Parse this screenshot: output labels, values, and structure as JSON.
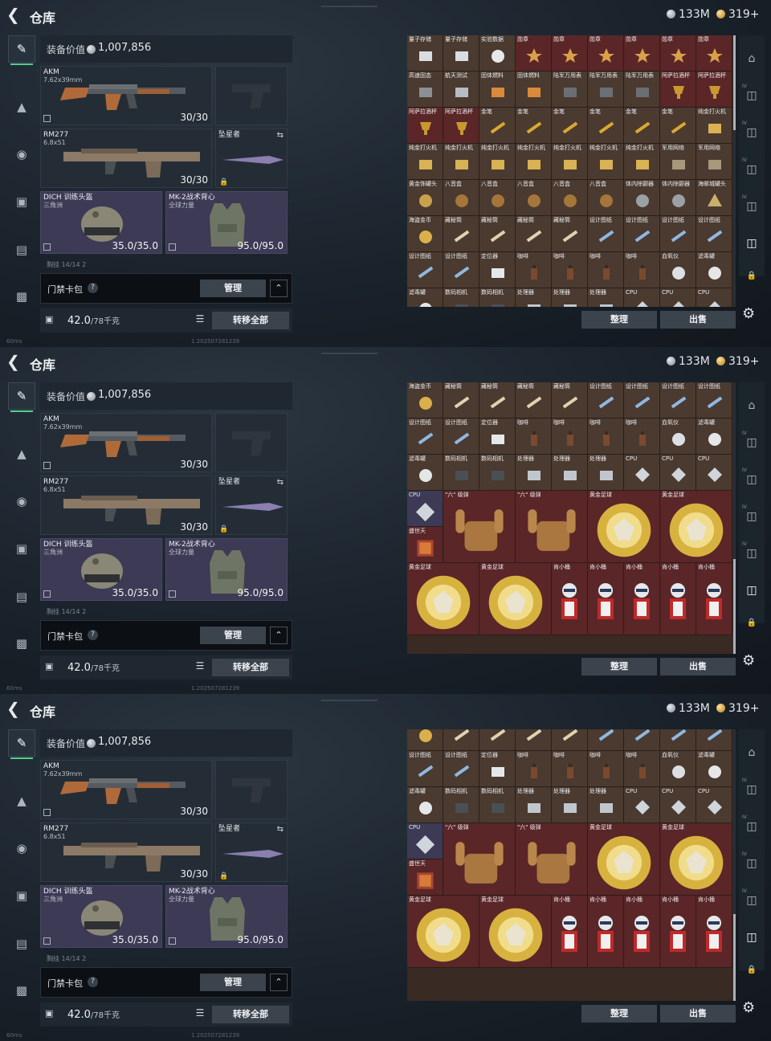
{
  "header": {
    "back_icon": "back-arrow-icon",
    "title": "仓库",
    "silver_currency": "133M",
    "gold_currency": "319+"
  },
  "left_panel": {
    "value_label": "装备价值",
    "value_amount": "1,007,856",
    "slots": {
      "primary": {
        "name": "AKM",
        "sub": "7.62x39mm",
        "count": "30/30"
      },
      "secondary": {
        "name": "RM277",
        "sub": "6.8x51",
        "count": "30/30"
      },
      "melee": {
        "name": "坠星者"
      },
      "helmet": {
        "name": "DICH 训练头盔",
        "sub": "三角洲",
        "count": "35.0/35.0"
      },
      "armor": {
        "name": "MK-2战术背心",
        "sub": "全球力量",
        "count": "95.0/95.0"
      },
      "backpack_hint": "胸挂 14/14 2"
    },
    "card_pack_label": "门禁卡包",
    "question_mark": "?",
    "manage_label": "管理",
    "chevron": "^",
    "weight_value": "42.0",
    "weight_max": "/78千克",
    "transfer_all_label": "转移全部"
  },
  "grid_actions": {
    "sort_label": "整理",
    "sell_label": "出售"
  },
  "status": {
    "left": "60ms",
    "mid": "1.202507281239"
  },
  "frames": [
    {
      "rows": [
        [
          "量子存储",
          "量子存储",
          "实验数据",
          "勋章",
          "勋章",
          "勋章",
          "勋章",
          "勋章",
          "勋章"
        ],
        [
          "高速固态",
          "航天测试",
          "固体燃料",
          "固体燃料",
          "陆军万用表",
          "陆军万用表",
          "陆军万用表",
          "阿萨拉酒杯",
          "阿萨拉酒杯"
        ],
        [
          "阿萨拉酒杯",
          "阿萨拉酒杯",
          "金笔",
          "金笔",
          "金笔",
          "金笔",
          "金笔",
          "金笔",
          "纯金打火机"
        ],
        [
          "纯金打火机",
          "纯金打火机",
          "纯金打火机",
          "纯金打火机",
          "纯金打火机",
          "纯金打火机",
          "纯金打火机",
          "军用网络",
          "军用网络"
        ],
        [
          "黄金饰罐头",
          "八音盒",
          "八音盒",
          "八音盒",
          "八音盒",
          "八音盒",
          "体内除颤器",
          "体内除颤器",
          "海邮城罐头"
        ],
        [
          "海盗金币",
          "藏秘筒",
          "藏秘筒",
          "藏秘筒",
          "藏秘筒",
          "设计图纸",
          "设计图纸",
          "设计图纸",
          "设计图纸"
        ],
        [
          "设计图纸",
          "设计图纸",
          "定位器",
          "咖啡",
          "咖啡",
          "咖啡",
          "咖啡",
          "血氧仪",
          "滤毒罐"
        ],
        [
          "滤毒罐",
          "数码相机",
          "数码相机",
          "处理器",
          "处理器",
          "处理器",
          "CPU",
          "CPU",
          "CPU"
        ]
      ],
      "scroll_top_pct": 0.0,
      "scroll_len_pct": 0.35
    },
    {
      "rows": [
        [
          "海盗金币",
          "藏秘筒",
          "藏秘筒",
          "藏秘筒",
          "藏秘筒",
          "设计图纸",
          "设计图纸",
          "设计图纸",
          "设计图纸"
        ],
        [
          "设计图纸",
          "设计图纸",
          "定位器",
          "咖啡",
          "咖啡",
          "咖啡",
          "咖啡",
          "血氧仪",
          "滤毒罐"
        ],
        [
          "滤毒罐",
          "数码相机",
          "数码相机",
          "处理器",
          "处理器",
          "处理器",
          "CPU",
          "CPU",
          "CPU"
        ]
      ],
      "big_items": [
        {
          "name": "CPU",
          "kind": "cpu"
        },
        {
          "name": "\"六\" 级弹",
          "kind": "hand"
        },
        {
          "name": "\"六\" 级弹",
          "kind": "hand"
        },
        {
          "name": "黄金足球",
          "kind": "ball"
        },
        {
          "name": "黄金足球",
          "kind": "ball"
        },
        {
          "name": "盛世天",
          "kind": "painting"
        },
        {
          "name": "黄金足球",
          "kind": "ball"
        },
        {
          "name": "黄金足球",
          "kind": "ball"
        },
        {
          "name": "肯小桶",
          "kind": "bucket"
        }
      ],
      "scroll_top_pct": 0.65,
      "scroll_len_pct": 0.35
    },
    {
      "rows": [
        [
          "海盗金币",
          "藏秘筒",
          "藏秘筒",
          "藏秘筒",
          "藏秘筒",
          "设计图纸",
          "设计图纸",
          "设计图纸",
          "设计图纸"
        ],
        [
          "设计图纸",
          "设计图纸",
          "定位器",
          "咖啡",
          "咖啡",
          "咖啡",
          "咖啡",
          "血氧仪",
          "滤毒罐"
        ],
        [
          "滤毒罐",
          "数码相机",
          "数码相机",
          "处理器",
          "处理器",
          "处理器",
          "CPU",
          "CPU",
          "CPU"
        ]
      ],
      "scroll_top_pct": 0.68,
      "scroll_len_pct": 0.32
    }
  ],
  "bucket_label": "肯小桶",
  "colors": {
    "accent_green": "#4fd18b",
    "cell_brown": "#4a3a30",
    "cell_red": "#5a2628",
    "panel_dark": "#1f2730"
  }
}
